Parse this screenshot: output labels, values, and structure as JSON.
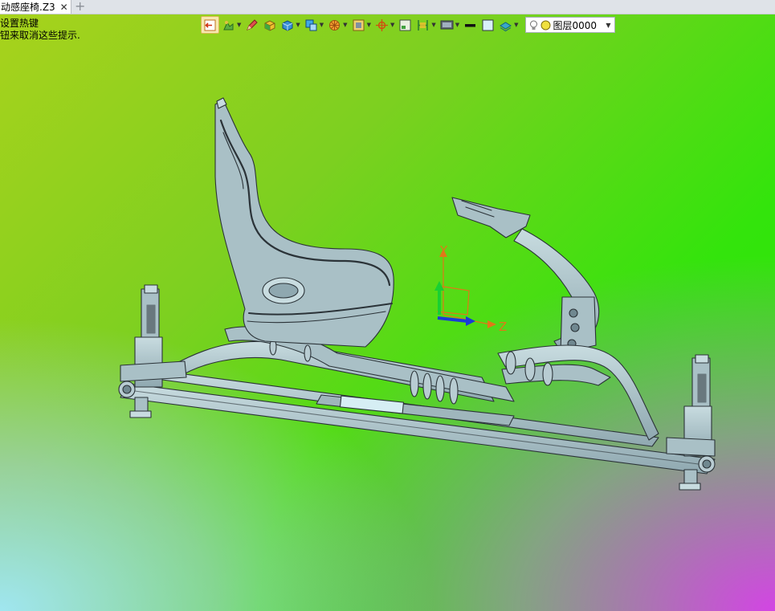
{
  "tab": {
    "title": "动感座椅.Z3",
    "close_glyph": "✕",
    "new_glyph": "+"
  },
  "hint": {
    "line1": "设置热键",
    "line2": "钮来取消这些提示."
  },
  "toolbar": {
    "items": [
      "exit-sketch-icon",
      "draw-style-icon",
      "pencil-icon",
      "solid-shaded-icon",
      "box-view-icon",
      "view-orient-icon",
      "sun-icon",
      "frame-icon",
      "compass-icon",
      "fit-view-icon",
      "section-view-icon",
      "display-icon",
      "line-weight-icon",
      "color-swatch-icon",
      "stack-icon"
    ],
    "layer_label": "图层0000"
  },
  "triad": {
    "y_label": "Y",
    "z_label": "Z"
  },
  "colors": {
    "part": "#a9c0c6",
    "edge": "#2b3338",
    "axis_y": "#19d032",
    "axis_z": "#1a3ad8",
    "axis_ref": "#e07818"
  }
}
